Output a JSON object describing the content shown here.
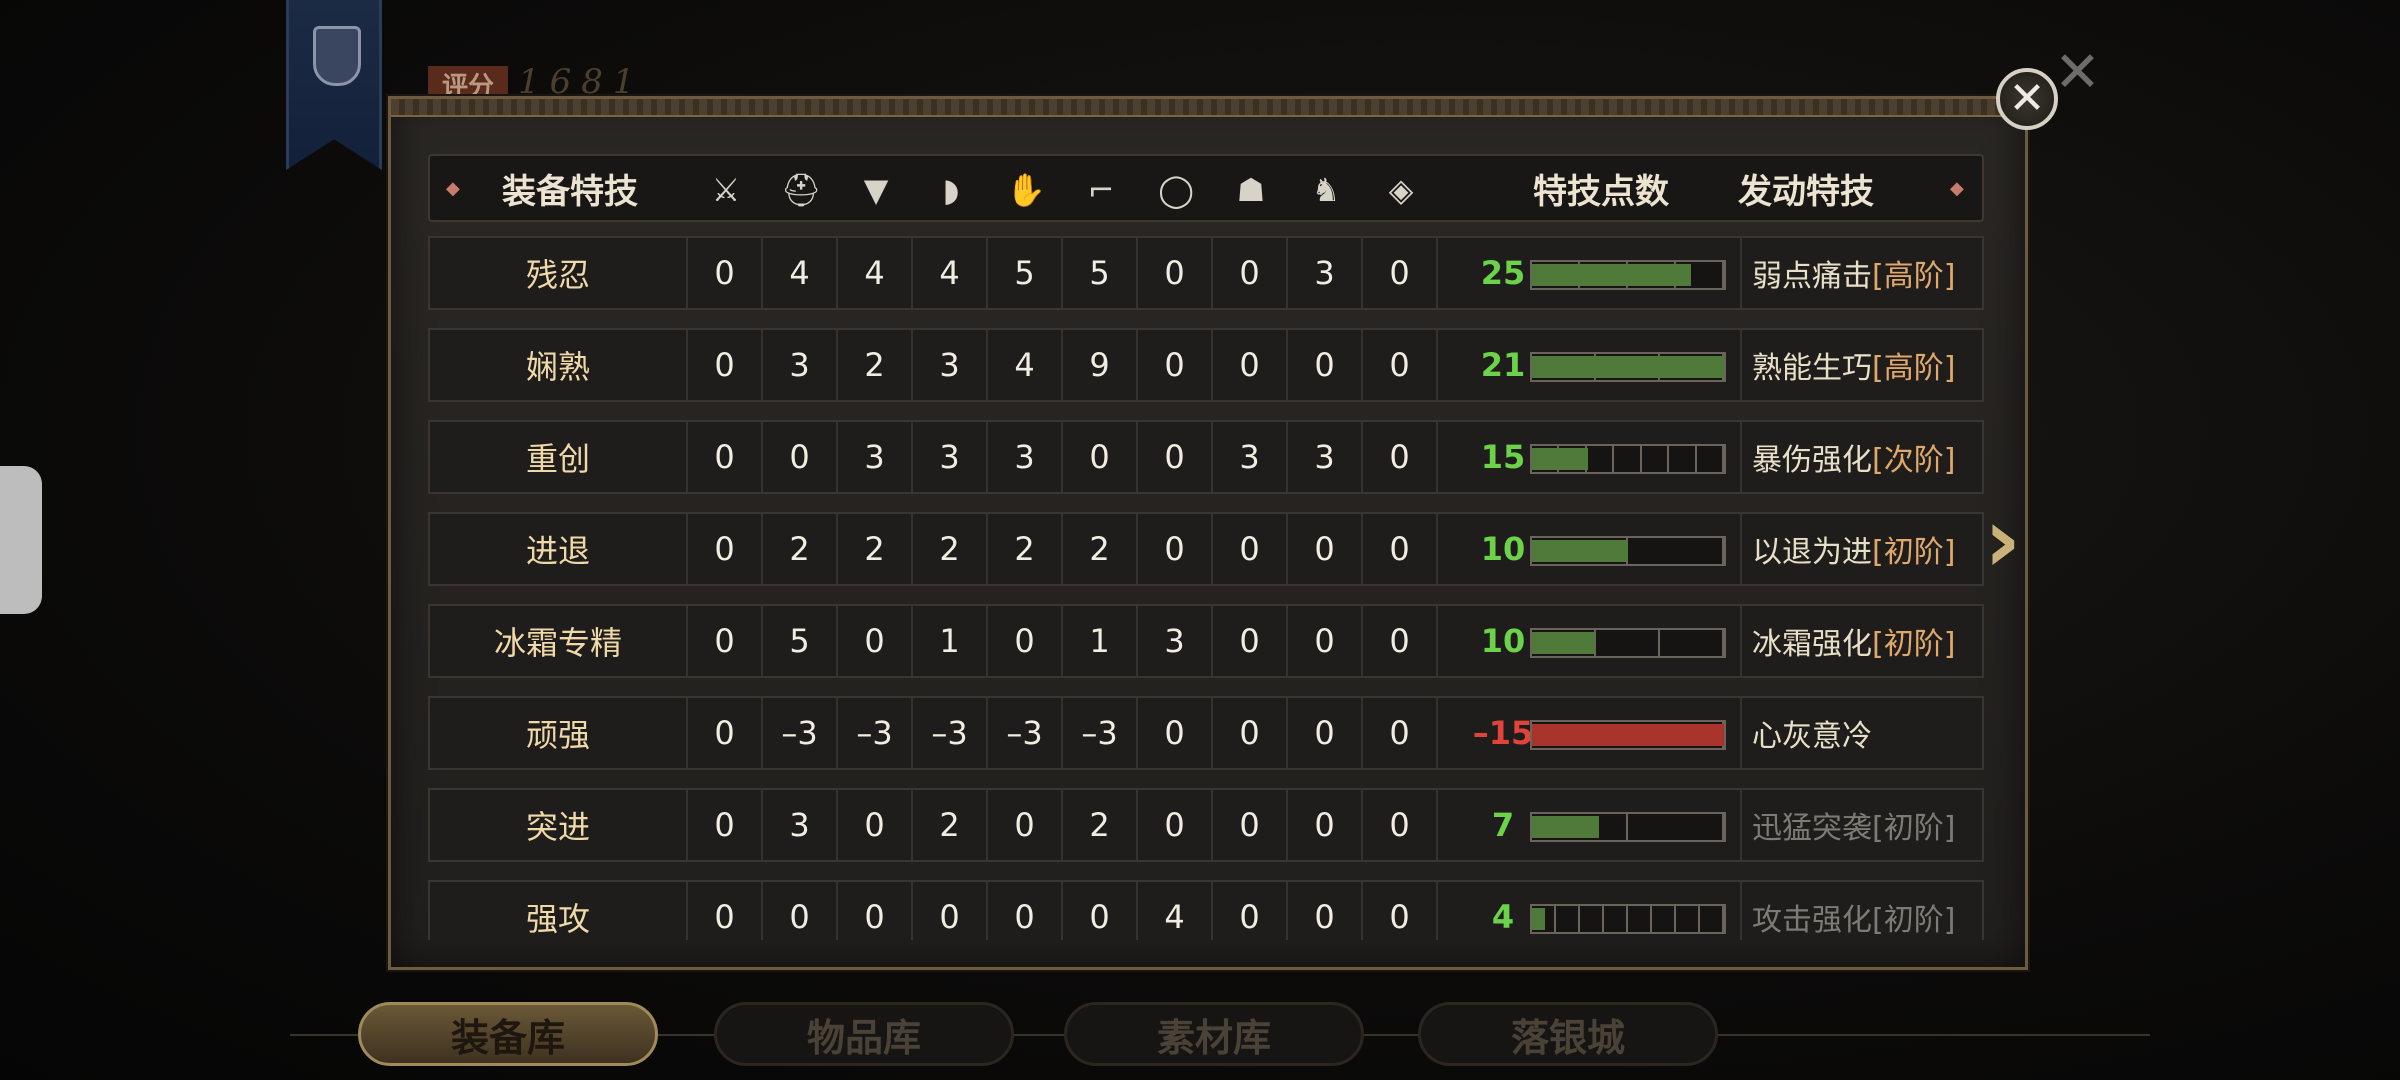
{
  "score": {
    "label": "评分",
    "value": "1681"
  },
  "header": {
    "col_name": "装备特技",
    "col_points": "特技点数",
    "col_skill": "发动特技",
    "slot_icons": [
      "sword-icon",
      "helmet-icon",
      "chest-armor-icon",
      "shoulder-icon",
      "gauntlet-icon",
      "boots-icon",
      "ring-icon",
      "mask-icon",
      "horse-icon",
      "amulet-icon"
    ]
  },
  "rows": [
    {
      "name": "残忍",
      "vals": [
        "0",
        "4",
        "4",
        "4",
        "5",
        "5",
        "0",
        "0",
        "3",
        "0"
      ],
      "points": "25",
      "fill": 0.83,
      "segments": 4,
      "skill": "弱点痛击",
      "tier": "[高阶]",
      "dim": false,
      "neg": false
    },
    {
      "name": "娴熟",
      "vals": [
        "0",
        "3",
        "2",
        "3",
        "4",
        "9",
        "0",
        "0",
        "0",
        "0"
      ],
      "points": "21",
      "fill": 1.0,
      "segments": 3,
      "skill": "熟能生巧",
      "tier": "[高阶]",
      "dim": false,
      "neg": false
    },
    {
      "name": "重创",
      "vals": [
        "0",
        "0",
        "3",
        "3",
        "3",
        "0",
        "0",
        "3",
        "3",
        "0"
      ],
      "points": "15",
      "fill": 0.29,
      "segments": 7,
      "skill": "暴伤强化",
      "tier": "[次阶]",
      "dim": false,
      "neg": false
    },
    {
      "name": "进退",
      "vals": [
        "0",
        "2",
        "2",
        "2",
        "2",
        "2",
        "0",
        "0",
        "0",
        "0"
      ],
      "points": "10",
      "fill": 0.5,
      "segments": 2,
      "skill": "以退为进",
      "tier": "[初阶]",
      "dim": false,
      "neg": false
    },
    {
      "name": "冰霜专精",
      "vals": [
        "0",
        "5",
        "0",
        "1",
        "0",
        "1",
        "3",
        "0",
        "0",
        "0"
      ],
      "points": "10",
      "fill": 0.33,
      "segments": 3,
      "skill": "冰霜强化",
      "tier": "[初阶]",
      "dim": false,
      "neg": false
    },
    {
      "name": "顽强",
      "vals": [
        "0",
        "–3",
        "–3",
        "–3",
        "–3",
        "–3",
        "0",
        "0",
        "0",
        "0"
      ],
      "points": "–15",
      "fill": 1.0,
      "segments": 1,
      "skill": "心灰意冷",
      "tier": "",
      "dim": false,
      "neg": true
    },
    {
      "name": "突进",
      "vals": [
        "0",
        "3",
        "0",
        "2",
        "0",
        "2",
        "0",
        "0",
        "0",
        "0"
      ],
      "points": "7",
      "fill": 0.35,
      "segments": 2,
      "skill": "迅猛突袭",
      "tier": "[初阶]",
      "dim": true,
      "neg": false
    },
    {
      "name": "强攻",
      "vals": [
        "0",
        "0",
        "0",
        "0",
        "0",
        "0",
        "4",
        "0",
        "0",
        "0"
      ],
      "points": "4",
      "fill": 0.07,
      "segments": 8,
      "skill": "攻击强化",
      "tier": "[初阶]",
      "dim": true,
      "neg": false
    }
  ],
  "tabs": [
    "装备库",
    "物品库",
    "素材库",
    "落银城"
  ],
  "colors": {
    "positive": "#6cd24a",
    "negative": "#e0443a",
    "tier": "#e0a86a"
  }
}
